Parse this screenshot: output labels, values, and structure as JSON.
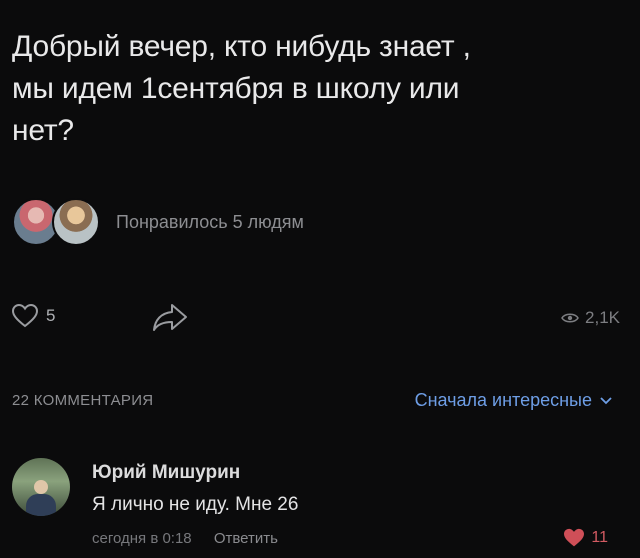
{
  "post": {
    "text": "Добрый вечер, кто нибудь знает ,\nмы идем 1сентября в школу или\nнет?"
  },
  "likers": {
    "text": "Понравилось 5 людям"
  },
  "actions": {
    "like_icon": "heart-outline-icon",
    "like_count": "5",
    "share_icon": "share-arrow-icon",
    "views_icon": "eye-icon",
    "views_count": "2,1K"
  },
  "comments_header": {
    "count_label": "22 КОММЕНТАРИЯ",
    "sort_label": "Сначала интересные",
    "sort_icon": "chevron-down-icon"
  },
  "comment": {
    "author": "Юрий Мишурин",
    "text": "Я лично не иду. Мне 26",
    "time": "сегодня в 0:18",
    "reply_label": "Ответить",
    "like_icon": "heart-filled-icon",
    "like_count": "11"
  },
  "colors": {
    "background": "#0b0b0c",
    "accent_link": "#6e9ee6",
    "like_red": "#cf4f58"
  }
}
